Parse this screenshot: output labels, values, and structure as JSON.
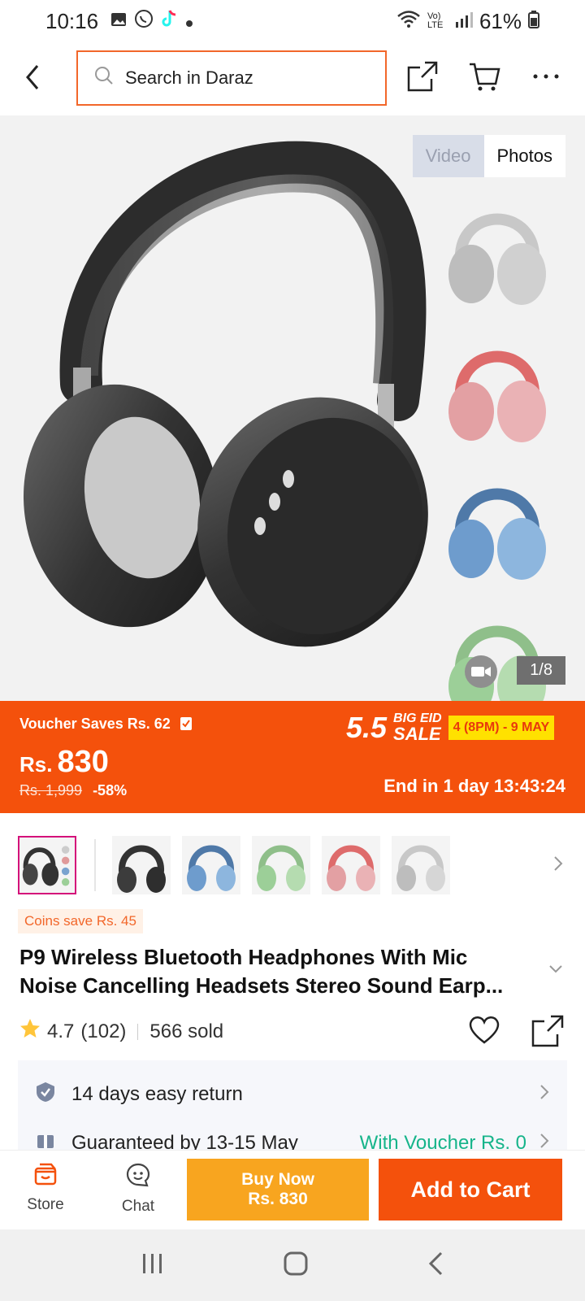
{
  "status_bar": {
    "time": "10:16",
    "battery": "61%",
    "network": "Vo) LTE"
  },
  "header": {
    "search_placeholder": "Search in Daraz"
  },
  "gallery": {
    "tabs": [
      "Video",
      "Photos"
    ],
    "active_tab": "Photos",
    "counter": "1/8",
    "side_thumbs": [
      "silver",
      "pink",
      "blue",
      "green"
    ]
  },
  "price_banner": {
    "voucher": "Voucher Saves Rs. 62",
    "currency": "Rs.",
    "price": "830",
    "original_price": "Rs. 1,999",
    "discount": "-58%",
    "sale_big": "5.5",
    "sale_line1": "BIG EID",
    "sale_line2": "SALE",
    "sale_dates": "4 (8PM) - 9 MAY",
    "end_in": "End in 1 day 13:43:24",
    "colors": {
      "banner": "#f4510c",
      "badge": "#ffe100"
    }
  },
  "variants": [
    "multi",
    "black",
    "blue",
    "green",
    "pink",
    "silver"
  ],
  "coins_tag": "Coins save Rs. 45",
  "product": {
    "title_line1": "P9 Wireless Bluetooth Headphones With Mic",
    "title_line2": "Noise Cancelling Headsets Stereo Sound Earp...",
    "rating": "4.7",
    "reviews": "(102)",
    "sold": "566 sold"
  },
  "services": {
    "return": "14 days easy return",
    "delivery": "Guaranteed by 13-15 May",
    "voucher": "With Voucher Rs. 0"
  },
  "bottom_bar": {
    "store": "Store",
    "chat": "Chat",
    "buy_now_line1": "Buy Now",
    "buy_now_line2": "Rs. 830",
    "add_to_cart": "Add to Cart"
  }
}
